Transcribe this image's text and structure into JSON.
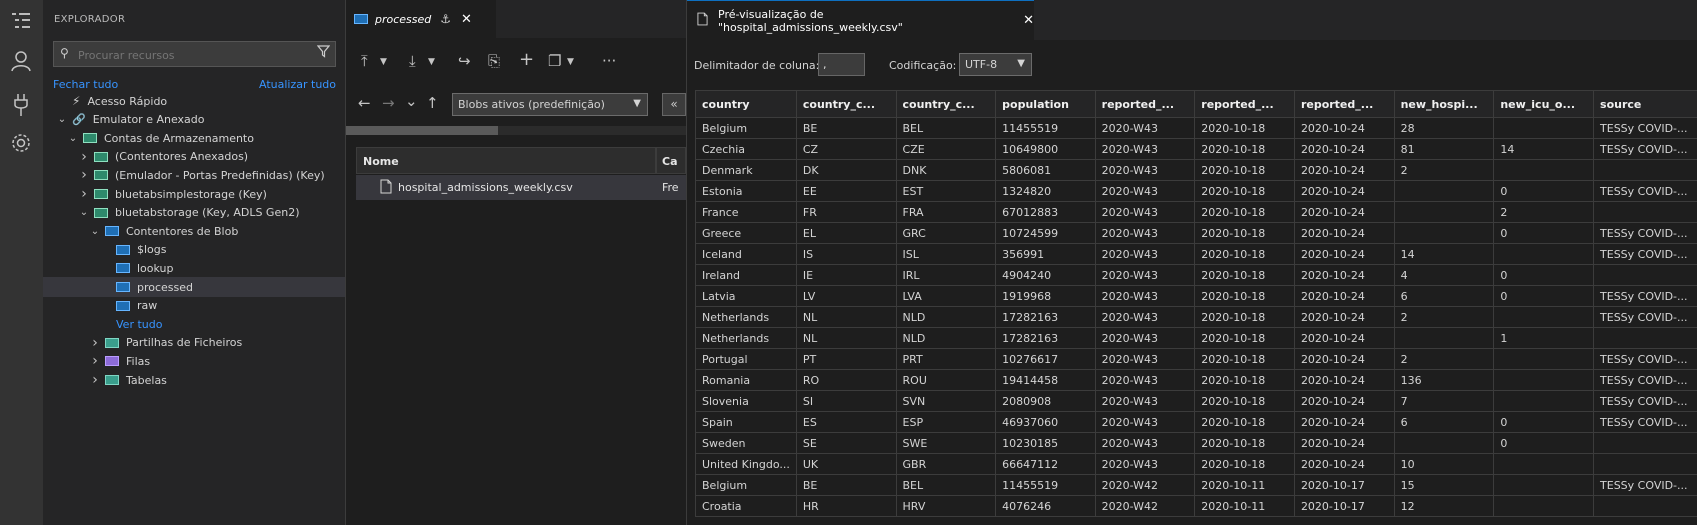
{
  "activity": [
    "explorer-icon",
    "account-icon",
    "plug-icon",
    "gear-icon"
  ],
  "explorer": {
    "title": "EXPLORADOR",
    "search_placeholder": "Procurar recursos",
    "collapse_all": "Fechar tudo",
    "refresh_all": "Atualizar tudo",
    "tree": [
      {
        "label": "Acesso Rápido",
        "depth": 1,
        "chev": "",
        "icon": "quick-access-icon"
      },
      {
        "label": "Emulator e Anexado",
        "depth": 1,
        "chev": "down",
        "icon": "link-icon"
      },
      {
        "label": "Contas de Armazenamento",
        "depth": 2,
        "chev": "down",
        "icon": "storage-account-icon"
      },
      {
        "label": "(Contentores Anexados)",
        "depth": 3,
        "chev": "right",
        "icon": "storage-account-icon"
      },
      {
        "label": "(Emulador - Portas Predefinidas) (Key)",
        "depth": 3,
        "chev": "right",
        "icon": "storage-account-icon"
      },
      {
        "label": "bluetabsimplestorage (Key)",
        "depth": 3,
        "chev": "right",
        "icon": "storage-account-icon"
      },
      {
        "label": "bluetabstorage (Key, ADLS Gen2)",
        "depth": 3,
        "chev": "down",
        "icon": "storage-account-icon"
      },
      {
        "label": "Contentores de Blob",
        "depth": 4,
        "chev": "down",
        "icon": "blob-containers-icon"
      },
      {
        "label": "$logs",
        "depth": 5,
        "chev": "",
        "icon": "blob-container-icon"
      },
      {
        "label": "lookup",
        "depth": 5,
        "chev": "",
        "icon": "blob-container-icon"
      },
      {
        "label": "processed",
        "depth": 5,
        "chev": "",
        "icon": "blob-container-icon",
        "selected": true
      },
      {
        "label": "raw",
        "depth": 5,
        "chev": "",
        "icon": "blob-container-icon"
      },
      {
        "label": "Ver tudo",
        "depth": 5,
        "chev": "",
        "icon": "",
        "link": true
      },
      {
        "label": "Partilhas de Ficheiros",
        "depth": 4,
        "chev": "right",
        "icon": "file-share-icon"
      },
      {
        "label": "Filas",
        "depth": 4,
        "chev": "right",
        "icon": "queue-icon"
      },
      {
        "label": "Tabelas",
        "depth": 4,
        "chev": "right",
        "icon": "table-icon"
      }
    ]
  },
  "middle": {
    "tab_label": "processed",
    "view_select": "Blobs ativos (predefinição)",
    "col_name": "Nome",
    "col_ca": "Ca",
    "file_name": "hospital_admissions_weekly.csv",
    "file_ca": "Fre"
  },
  "preview": {
    "tab_label": "Pré-visualização de \"hospital_admissions_weekly.csv\"",
    "delimiter_label": "Delimitador de coluna:",
    "delimiter_value": ",",
    "encoding_label": "Codificação:",
    "encoding_value": "UTF-8",
    "headers": [
      "country",
      "country_c...",
      "country_c...",
      "population",
      "reported_...",
      "reported_...",
      "reported_...",
      "new_hospi...",
      "new_icu_o...",
      "source"
    ],
    "rows": [
      [
        "Belgium",
        "BE",
        "BEL",
        "11455519",
        "2020-W43",
        "2020-10-18",
        "2020-10-24",
        "28",
        "",
        "TESSy COVID-..."
      ],
      [
        "Czechia",
        "CZ",
        "CZE",
        "10649800",
        "2020-W43",
        "2020-10-18",
        "2020-10-24",
        "81",
        "14",
        "TESSy COVID-..."
      ],
      [
        "Denmark",
        "DK",
        "DNK",
        "5806081",
        "2020-W43",
        "2020-10-18",
        "2020-10-24",
        "2",
        "",
        ""
      ],
      [
        "Estonia",
        "EE",
        "EST",
        "1324820",
        "2020-W43",
        "2020-10-18",
        "2020-10-24",
        "",
        "0",
        "TESSy COVID-..."
      ],
      [
        "France",
        "FR",
        "FRA",
        "67012883",
        "2020-W43",
        "2020-10-18",
        "2020-10-24",
        "",
        "2",
        ""
      ],
      [
        "Greece",
        "EL",
        "GRC",
        "10724599",
        "2020-W43",
        "2020-10-18",
        "2020-10-24",
        "",
        "0",
        "TESSy COVID-..."
      ],
      [
        "Iceland",
        "IS",
        "ISL",
        "356991",
        "2020-W43",
        "2020-10-18",
        "2020-10-24",
        "14",
        "",
        "TESSy COVID-..."
      ],
      [
        "Ireland",
        "IE",
        "IRL",
        "4904240",
        "2020-W43",
        "2020-10-18",
        "2020-10-24",
        "4",
        "0",
        ""
      ],
      [
        "Latvia",
        "LV",
        "LVA",
        "1919968",
        "2020-W43",
        "2020-10-18",
        "2020-10-24",
        "6",
        "0",
        "TESSy COVID-..."
      ],
      [
        "Netherlands",
        "NL",
        "NLD",
        "17282163",
        "2020-W43",
        "2020-10-18",
        "2020-10-24",
        "2",
        "",
        "TESSy COVID-..."
      ],
      [
        "Netherlands",
        "NL",
        "NLD",
        "17282163",
        "2020-W43",
        "2020-10-18",
        "2020-10-24",
        "",
        "1",
        ""
      ],
      [
        "Portugal",
        "PT",
        "PRT",
        "10276617",
        "2020-W43",
        "2020-10-18",
        "2020-10-24",
        "2",
        "",
        "TESSy COVID-..."
      ],
      [
        "Romania",
        "RO",
        "ROU",
        "19414458",
        "2020-W43",
        "2020-10-18",
        "2020-10-24",
        "136",
        "",
        "TESSy COVID-..."
      ],
      [
        "Slovenia",
        "SI",
        "SVN",
        "2080908",
        "2020-W43",
        "2020-10-18",
        "2020-10-24",
        "7",
        "",
        "TESSy COVID-..."
      ],
      [
        "Spain",
        "ES",
        "ESP",
        "46937060",
        "2020-W43",
        "2020-10-18",
        "2020-10-24",
        "6",
        "0",
        "TESSy COVID-..."
      ],
      [
        "Sweden",
        "SE",
        "SWE",
        "10230185",
        "2020-W43",
        "2020-10-18",
        "2020-10-24",
        "",
        "0",
        ""
      ],
      [
        "United Kingdo...",
        "UK",
        "GBR",
        "66647112",
        "2020-W43",
        "2020-10-18",
        "2020-10-24",
        "10",
        "",
        ""
      ],
      [
        "Belgium",
        "BE",
        "BEL",
        "11455519",
        "2020-W42",
        "2020-10-11",
        "2020-10-17",
        "15",
        "",
        "TESSy COVID-..."
      ],
      [
        "Croatia",
        "HR",
        "HRV",
        "4076246",
        "2020-W42",
        "2020-10-11",
        "2020-10-17",
        "12",
        "",
        ""
      ]
    ]
  }
}
